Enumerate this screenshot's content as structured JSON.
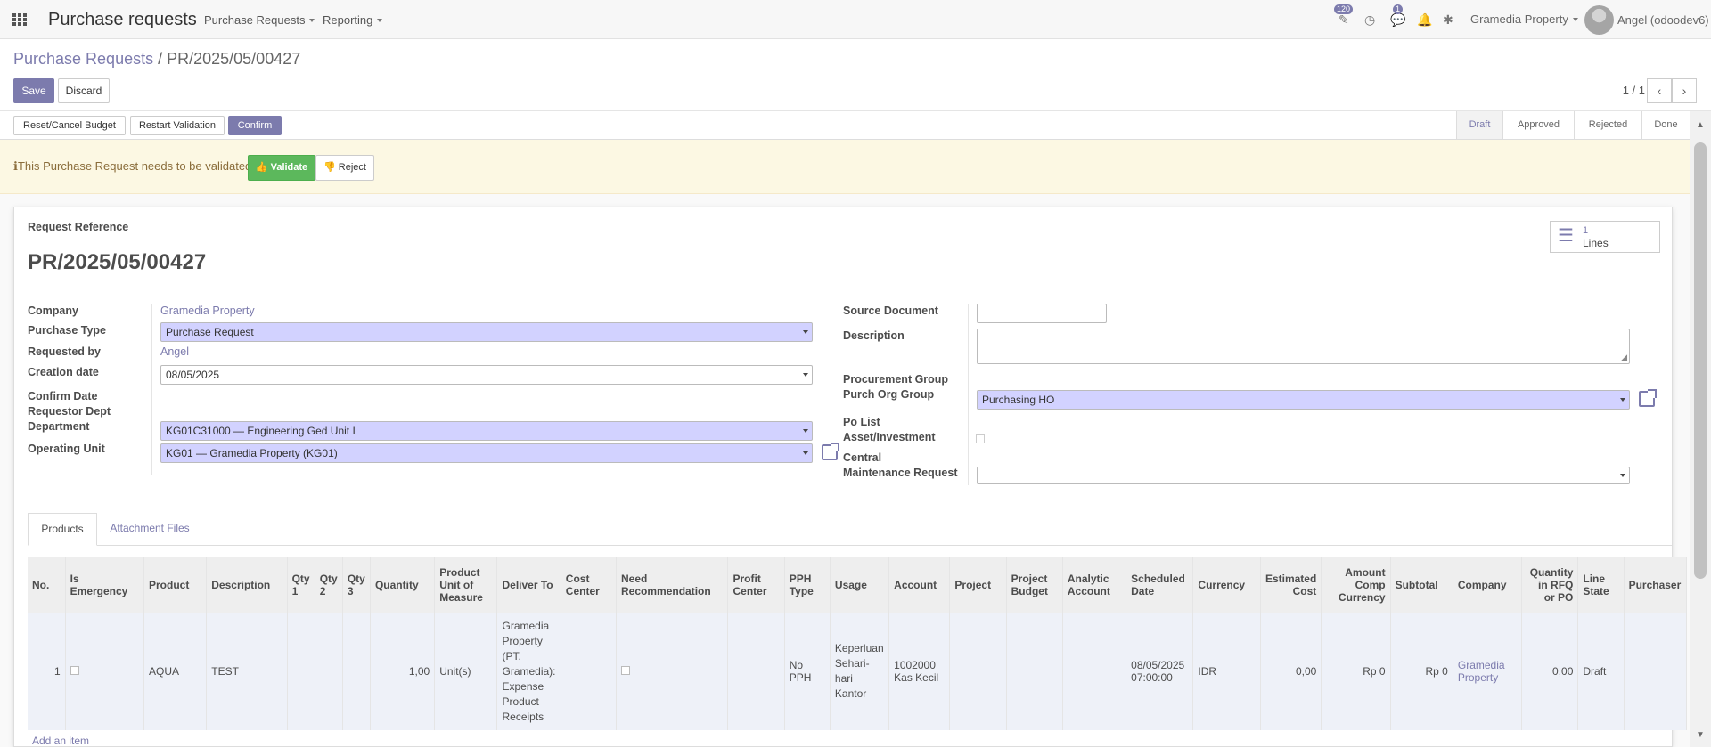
{
  "app_title": "Purchase requests",
  "top_menu": [
    "Purchase Requests",
    "Reporting"
  ],
  "systray": {
    "activity_badge": "120",
    "messages_badge": "1",
    "company": "Gramedia Property",
    "user": "Angel (odoodev6)"
  },
  "breadcrumb": {
    "parent": "Purchase Requests",
    "separator": "/",
    "current": "PR/2025/05/00427"
  },
  "buttons": {
    "save": "Save",
    "discard": "Discard",
    "reset_cancel_budget": "Reset/Cancel Budget",
    "restart_validation": "Restart Validation",
    "confirm": "Confirm",
    "validate": "Validate",
    "reject": "Reject"
  },
  "pager": "1 / 1",
  "stages": [
    "Draft",
    "Approved",
    "Rejected",
    "Done"
  ],
  "active_stage": "Draft",
  "alert_message": "This Purchase Request needs to be validated.",
  "smart_button": {
    "count": "1",
    "label": "Lines"
  },
  "form": {
    "ref_label": "Request Reference",
    "ref_value": "PR/2025/05/00427",
    "company_label": "Company",
    "company_value": "Gramedia Property",
    "purchase_type_label": "Purchase Type",
    "purchase_type_value": "Purchase Request",
    "requested_by_label": "Requested by",
    "requested_by_value": "Angel",
    "creation_date_label": "Creation date",
    "creation_date_value": "08/05/2025",
    "confirm_date_label": "Confirm Date",
    "requestor_dept_label": "Requestor Dept",
    "department_label": "Department",
    "department_value": "KG01C31000 — Engineering Ged Unit I",
    "operating_unit_label": "Operating Unit",
    "operating_unit_value": "KG01 — Gramedia Property (KG01)",
    "source_doc_label": "Source Document",
    "source_doc_value": "",
    "description_label": "Description",
    "description_value": "",
    "procurement_group_label": "Procurement Group",
    "purch_org_group_label": "Purch Org Group",
    "purch_org_group_value": "Purchasing HO",
    "po_list_label": "Po List",
    "asset_label": "Asset/Investment",
    "central_label": "Central",
    "maint_request_label": "Maintenance Request",
    "maint_request_value": ""
  },
  "tabs": [
    "Products",
    "Attachment Files"
  ],
  "table": {
    "headers": [
      "No.",
      "Is Emergency",
      "Product",
      "Description",
      "Qty 1",
      "Qty 2",
      "Qty 3",
      "Quantity",
      "Product Unit of Measure",
      "Deliver To",
      "Cost Center",
      "Need Recommendation",
      "Profit Center",
      "PPH Type",
      "Usage",
      "Account",
      "Project",
      "Project Budget",
      "Analytic Account",
      "Scheduled Date",
      "Currency",
      "Estimated Cost",
      "Amount Comp Currency",
      "Subtotal",
      "Company",
      "Quantity in RFQ or PO",
      "Line State",
      "Purchaser"
    ],
    "row": {
      "no": "1",
      "product": "AQUA",
      "description": "TEST",
      "quantity": "1,00",
      "uom": "Unit(s)",
      "deliver_to": "Gramedia Property (PT. Gramedia): Expense Product Receipts",
      "pph_type": "No PPH",
      "usage": "Keperluan Sehari-hari Kantor",
      "account": "1002000 Kas Kecil",
      "scheduled_date": "08/05/2025 07:00:00",
      "currency": "IDR",
      "estimated_cost": "0,00",
      "amount_comp": "Rp 0",
      "subtotal": "Rp 0",
      "company": "Gramedia Property",
      "qty_rfq": "0,00",
      "line_state": "Draft"
    },
    "add_item": "Add an item"
  }
}
